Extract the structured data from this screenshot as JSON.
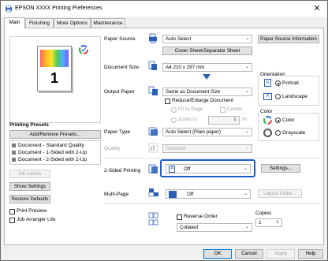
{
  "window": {
    "title": "EPSON XXXX Printing Preferences"
  },
  "tabs": [
    {
      "label": "Main"
    },
    {
      "label": "Finishing"
    },
    {
      "label": "More Options"
    },
    {
      "label": "Maintenance"
    }
  ],
  "left": {
    "presets_title": "Printing Presets",
    "add_remove_label": "Add/Remove Presets...",
    "presets": [
      "Document - Standard Quality",
      "Document - 1-Sided with 2-Up",
      "Document - 2-Sided with 2-Up"
    ],
    "ink_levels_label": "Ink Levels",
    "show_settings_label": "Show Settings",
    "restore_defaults_label": "Restore Defaults",
    "print_preview_label": "Print Preview",
    "job_arranger_label": "Job Arranger Lite",
    "preview_page_number": "1"
  },
  "paper_source": {
    "label": "Paper Source",
    "value": "Auto Select",
    "info_label": "Paper Source Information",
    "cover_sheet_label": "Cover Sheet/Separator Sheet"
  },
  "document_size": {
    "label": "Document Size",
    "value": "A4 210 x 297 mm"
  },
  "orientation": {
    "title": "Orientation",
    "portrait": "Portrait",
    "landscape": "Landscape",
    "selected": "Portrait"
  },
  "output_paper": {
    "label": "Output Paper",
    "value": "Same as Document Size",
    "reduce_label": "Reduce/Enlarge Document",
    "fit_to_page": "Fit to Page",
    "center": "Center",
    "zoom_to": "Zoom to",
    "percent": "%"
  },
  "color": {
    "title": "Color",
    "color": "Color",
    "grayscale": "Grayscale",
    "selected": "Color"
  },
  "paper_type": {
    "label": "Paper Type",
    "value": "Auto Select (Plain paper)"
  },
  "quality": {
    "label": "Quality",
    "value": "Standard"
  },
  "two_sided": {
    "label": "2-Sided Printing",
    "value": "Off",
    "settings_label": "Settings..."
  },
  "multi_page": {
    "label": "Multi-Page",
    "value": "Off",
    "layout_order_label": "Layout Order..."
  },
  "reverse": {
    "label": "Reverse Order"
  },
  "collate": {
    "value": "Collated"
  },
  "copies": {
    "label": "Copies",
    "value": "1"
  },
  "footer": {
    "ok": "OK",
    "cancel": "Cancel",
    "apply": "Apply",
    "help": "Help"
  }
}
